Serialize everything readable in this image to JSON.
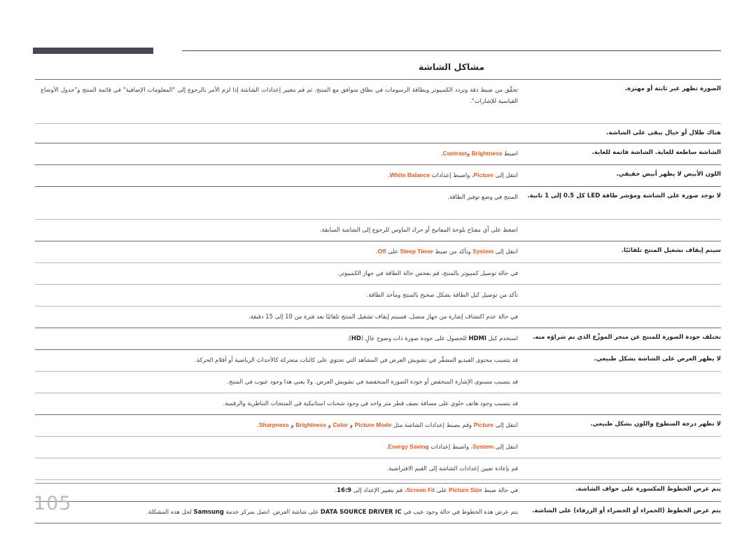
{
  "document": {
    "title": "مشاكل الشاشة",
    "page_number": "105",
    "accent_color": "#e8591f",
    "header_bar_color": "#484557",
    "page_number_color": "#b9b9c2"
  },
  "table": {
    "rows": [
      {
        "problem": "الصورة تظهر غير ثابتة أو مهتزة.",
        "solution_parts": [
          {
            "t": "text",
            "v": "تحقَّق من ضبط دقة وتردد الكمبيوتر وبطاقة الرسومات في نطاق متوافق مع المنتج. ثم قم بتغيير إعدادات الشاشة إذا لزم الأمر بالرجوع إلى \"المعلومات الإضافية\" في قائمة المنتج و\"جدول الأوضاع القياسية للإشارات\"."
          }
        ]
      },
      {
        "problem": "هناك ظلال أو خيال يبقى على الشاشة.",
        "solution_parts": []
      },
      {
        "problem": "الشاشة ساطعة للغاية. الشاشة قاتمة للغاية.",
        "solution_parts": [
          {
            "t": "text",
            "v": "اضبط "
          },
          {
            "t": "en",
            "v": "Brightness"
          },
          {
            "t": "text",
            "v": " و"
          },
          {
            "t": "en",
            "v": "Contrast"
          },
          {
            "t": "text",
            "v": "."
          }
        ]
      },
      {
        "problem": "اللون الأبيض لا يظهر أبيض حقيقي.",
        "solution_parts": [
          {
            "t": "text",
            "v": "انتقل إلى "
          },
          {
            "t": "en",
            "v": "Picture"
          },
          {
            "t": "text",
            "v": "، واضبط إعدادات "
          },
          {
            "t": "en",
            "v": "White Balance"
          },
          {
            "t": "text",
            "v": "."
          }
        ]
      },
      {
        "problem": "لا توجد صورة على الشاشة ومؤشر طاقة LED كل 0.5 إلى 1 ثانية.",
        "solution_parts": [
          {
            "t": "text",
            "v": "المنتج في وضع توفير الطاقة."
          }
        ]
      },
      {
        "problem": "",
        "solution_parts": [
          {
            "t": "text",
            "v": "اضغط على أي مفتاح بلوحة المفاتيح أو حرك الماوس للرجوع إلى الشاشة السابقة."
          }
        ]
      },
      {
        "problem": "سيتم إيقاف تشغيل المنتج تلقائيًا.",
        "solution_parts": [
          {
            "t": "text",
            "v": "انتقل إلى "
          },
          {
            "t": "en",
            "v": "System"
          },
          {
            "t": "text",
            "v": " وتأكد من ضبط "
          },
          {
            "t": "en",
            "v": "Sleep Timer"
          },
          {
            "t": "text",
            "v": " على "
          },
          {
            "t": "en",
            "v": "Off"
          },
          {
            "t": "text",
            "v": "."
          }
        ]
      },
      {
        "problem": "",
        "solution_parts": [
          {
            "t": "text",
            "v": "في حالة توصيل كمبيوتر بالمنتج، قم بفحص حالة الطاقة في جهاز الكمبيوتر."
          }
        ]
      },
      {
        "problem": "",
        "solution_parts": [
          {
            "t": "text",
            "v": "تأكد من توصيل كبل الطاقة بشكل صحيح بالمنتج ومأخذ الطاقة."
          }
        ]
      },
      {
        "problem": "",
        "solution_parts": [
          {
            "t": "text",
            "v": "في حالة عدم اكتشاف إشارة من جهاز متصل، فسيتم إيقاف تشغيل المنتج تلقائيًا بعد فترة من 10 إلى 15 دقيقة."
          }
        ]
      },
      {
        "problem": "تختلف جودة الصورة للمنتج عن متجر الموزِّع الذي تم شراؤه منه.",
        "solution_parts": [
          {
            "t": "text",
            "v": "استخدم كبل "
          },
          {
            "t": "bk",
            "v": "HDMI"
          },
          {
            "t": "text",
            "v": " للحصول على جودة صورة ذات وضوح عالٍ ("
          },
          {
            "t": "bk",
            "v": "HD"
          },
          {
            "t": "text",
            "v": ")."
          }
        ]
      },
      {
        "problem": "لا يظهر العرض على الشاشة بشكل طبيعي.",
        "solution_parts": [
          {
            "t": "text",
            "v": "قد يتسبب محتوى الفيديو المشفَّر في تشويش العرض في المشاهد التي تحتوي على كائنات متحركة كالأحداث الرياضية أو أفلام الحركة."
          }
        ]
      },
      {
        "problem": "",
        "solution_parts": [
          {
            "t": "text",
            "v": "قد يتسبب مستوى الإشارة المنخفض أو جودة الصورة المنخفضة في تشويش العرض. ولا يعني هذا وجود عيوب في المنتج."
          }
        ]
      },
      {
        "problem": "",
        "solution_parts": [
          {
            "t": "text",
            "v": "قد يتسبب وجود هاتف خلوي على مسافة نصف قطر متر واحد في وجود شحنات استاتيكية في المنتجات التناظرية والرقمية."
          }
        ]
      },
      {
        "problem": "لا تظهر درجة السطوع واللون بشكل طبيعي.",
        "solution_parts": [
          {
            "t": "text",
            "v": "انتقل إلى "
          },
          {
            "t": "en",
            "v": "Picture"
          },
          {
            "t": "text",
            "v": " وقم بضبط إعدادات الشاشة مثل "
          },
          {
            "t": "en",
            "v": "Picture Mode"
          },
          {
            "t": "text",
            "v": " و "
          },
          {
            "t": "en",
            "v": "Color"
          },
          {
            "t": "text",
            "v": " و "
          },
          {
            "t": "en",
            "v": "Brightness"
          },
          {
            "t": "text",
            "v": " و "
          },
          {
            "t": "en",
            "v": "Sharpness"
          },
          {
            "t": "text",
            "v": "."
          }
        ]
      },
      {
        "problem": "",
        "solution_parts": [
          {
            "t": "text",
            "v": "انتقل إلى "
          },
          {
            "t": "en",
            "v": "System"
          },
          {
            "t": "text",
            "v": "، واضبط إعدادات "
          },
          {
            "t": "en",
            "v": "Energy Saving"
          },
          {
            "t": "text",
            "v": "."
          }
        ]
      },
      {
        "problem": "",
        "solution_parts": [
          {
            "t": "text",
            "v": "قم بإعادة تعيين إعدادات الشاشة إلى القيم الافتراضية."
          }
        ]
      },
      {
        "problem": "يتم عرض الخطوط المكسورة على حواف الشاشة.",
        "solution_parts": [
          {
            "t": "text",
            "v": "في حالة ضبط "
          },
          {
            "t": "en",
            "v": "Picture Size"
          },
          {
            "t": "text",
            "v": " على "
          },
          {
            "t": "en",
            "v": "Screen Fit"
          },
          {
            "t": "text",
            "v": "، قم بتغيير الإعداد إلى "
          },
          {
            "t": "bk",
            "v": "16:9"
          },
          {
            "t": "text",
            "v": "."
          }
        ]
      },
      {
        "problem": "يتم عرض الخطوط (الحمراء أو الخضراء أو الزرقاء) على الشاشة.",
        "solution_parts": [
          {
            "t": "text",
            "v": "يتم عرض هذه الخطوط في حالة وجود عيب في "
          },
          {
            "t": "bk",
            "v": "DATA SOURCE DRIVER IC"
          },
          {
            "t": "text",
            "v": " على شاشة العرض. اتصل بمركز خدمة "
          },
          {
            "t": "bk",
            "v": "Samsung"
          },
          {
            "t": "text",
            "v": " لحل هذه المشكلة."
          }
        ]
      }
    ]
  }
}
